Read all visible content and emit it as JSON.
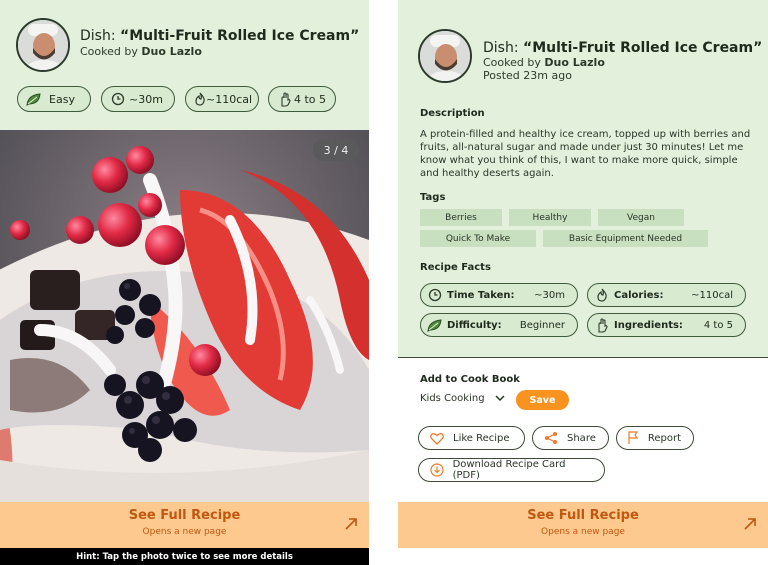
{
  "dish": {
    "prefix": "Dish:",
    "name": "“Multi-Fruit Rolled Ice Cream”",
    "cooked_by_prefix": "Cooked by",
    "author": "Duo Lazlo",
    "posted": "Posted 23m ago"
  },
  "left": {
    "chips": [
      {
        "icon": "leaf-icon",
        "label": "Easy"
      },
      {
        "icon": "clock-icon",
        "label": "~30m"
      },
      {
        "icon": "flame-icon",
        "label": "~110cal"
      },
      {
        "icon": "hand-icon",
        "label": "4 to 5"
      }
    ],
    "photo_counter": "3 / 4",
    "cta": {
      "title": "See Full Recipe",
      "subtitle": "Opens a new page"
    },
    "hint": "Hint: Tap the photo twice to see more details"
  },
  "right": {
    "description_title": "Description",
    "description": "A protein-filled and healthy ice cream, topped up with berries and fruits, all-natural sugar and made under just 30 minutes! Let me know what you think of this, I want to make more quick, simple and healthy deserts again.",
    "tags_title": "Tags",
    "tags": [
      "Berries",
      "Healthy",
      "Vegan",
      "Quick To Make",
      "Basic Equipment Needed"
    ],
    "facts_title": "Recipe Facts",
    "facts": [
      {
        "icon": "clock-icon",
        "label": "Time Taken:",
        "value": "~30m"
      },
      {
        "icon": "flame-icon",
        "label": "Calories:",
        "value": "~110cal"
      },
      {
        "icon": "leaf-icon",
        "label": "Difficulty:",
        "value": "Beginner"
      },
      {
        "icon": "hand-icon",
        "label": "Ingredients:",
        "value": "4 to 5"
      }
    ],
    "cookbook_title": "Add to Cook Book",
    "cookbook_selected": "Kids Cooking",
    "save_label": "Save",
    "actions": {
      "like": "Like Recipe",
      "share": "Share",
      "report": "Report",
      "download": "Download Recipe Card (PDF)"
    },
    "cta": {
      "title": "See Full Recipe",
      "subtitle": "Opens a new page"
    }
  },
  "colors": {
    "header_bg": "#e3f1dc",
    "chip_bg": "#d8ead0",
    "tag_bg": "#c8dfc0",
    "cta_bg": "#fdc98e",
    "cta_text": "#c05810",
    "save_bg": "#f7931e",
    "accent_orange": "#f07a2a"
  }
}
